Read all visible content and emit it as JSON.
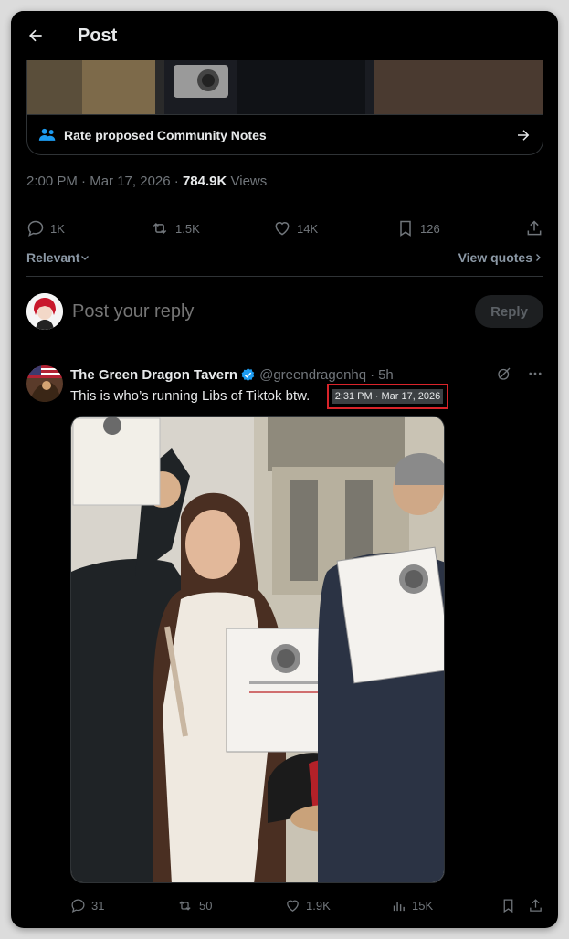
{
  "header": {
    "title": "Post"
  },
  "community_notes": {
    "label": "Rate proposed Community Notes"
  },
  "main_post": {
    "time": "2:00 PM",
    "date": "Mar 17, 2026",
    "views_count": "784.9K",
    "views_label": "Views",
    "replies": "1K",
    "reposts": "1.5K",
    "likes": "14K",
    "bookmarks": "126"
  },
  "sort": {
    "label": "Relevant",
    "view_quotes": "View quotes"
  },
  "reply": {
    "placeholder": "Post your reply",
    "button": "Reply"
  },
  "reply_post": {
    "name": "The Green Dragon Tavern",
    "handle": "@greendragonhq",
    "age": "5h",
    "text": "This is who’s running Libs of Tiktok btw.",
    "timestamp_badge": "2:31 PM · Mar 17, 2026",
    "replies": "31",
    "reposts": "50",
    "likes": "1.9K",
    "views": "15K"
  },
  "colors": {
    "accent": "#1d9bf0",
    "text": "#e7e9ea",
    "muted": "#71767b",
    "border": "#2f3336",
    "highlight": "#d9242a"
  }
}
